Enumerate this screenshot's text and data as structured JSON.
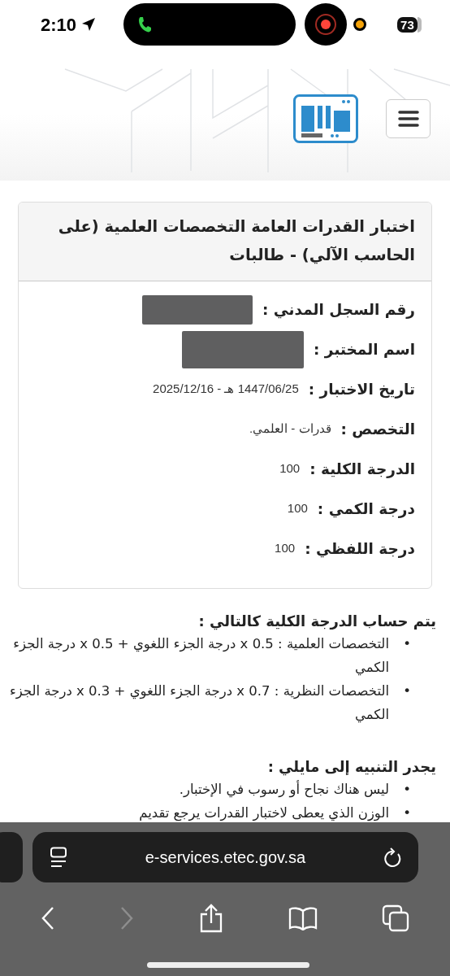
{
  "status_bar": {
    "time": "2:10",
    "battery": "73"
  },
  "result_card": {
    "title": "اختبار القدرات العامة التخصصات العلمية (على الحاسب الآلي) - طالبات",
    "fields": [
      {
        "label": "رقم السجل المدني :",
        "redacted": true
      },
      {
        "label": "اسم المختبر :",
        "redacted": true
      },
      {
        "label": "تاريخ الاختبار :",
        "value": "1447/06/25 هـ - 2025/12/16"
      },
      {
        "label": "التخصص :",
        "value": "قدرات - العلمي."
      },
      {
        "label": "الدرجة الكلية :",
        "value": "100"
      },
      {
        "label": "درجة الكمي :",
        "value": "100"
      },
      {
        "label": "درجة اللفظي :",
        "value": "100"
      }
    ]
  },
  "sections": [
    {
      "heading": "يتم حساب الدرجة الكلية كالتالي :",
      "marker": "•",
      "items": [
        "التخصصات العلمية : 0.5 x درجة الجزء اللغوي + 0.5 x درجة الجزء الكمي",
        "التخصصات النظرية : 0.7 x درجة الجزء اللغوي + 0.3 x درجة الجزء الكمي"
      ]
    },
    {
      "heading": "يجدر التنبيه إلى مايلي :",
      "marker": "•",
      "items": [
        "ليس هناك نجاح أو رسوب في الإختبار.",
        "الوزن الذي يعطى لاختبار القدرات يرجع تقديم"
      ]
    }
  ],
  "browser": {
    "url": "e-services.etec.gov.sa",
    "forward_disabled": true
  }
}
